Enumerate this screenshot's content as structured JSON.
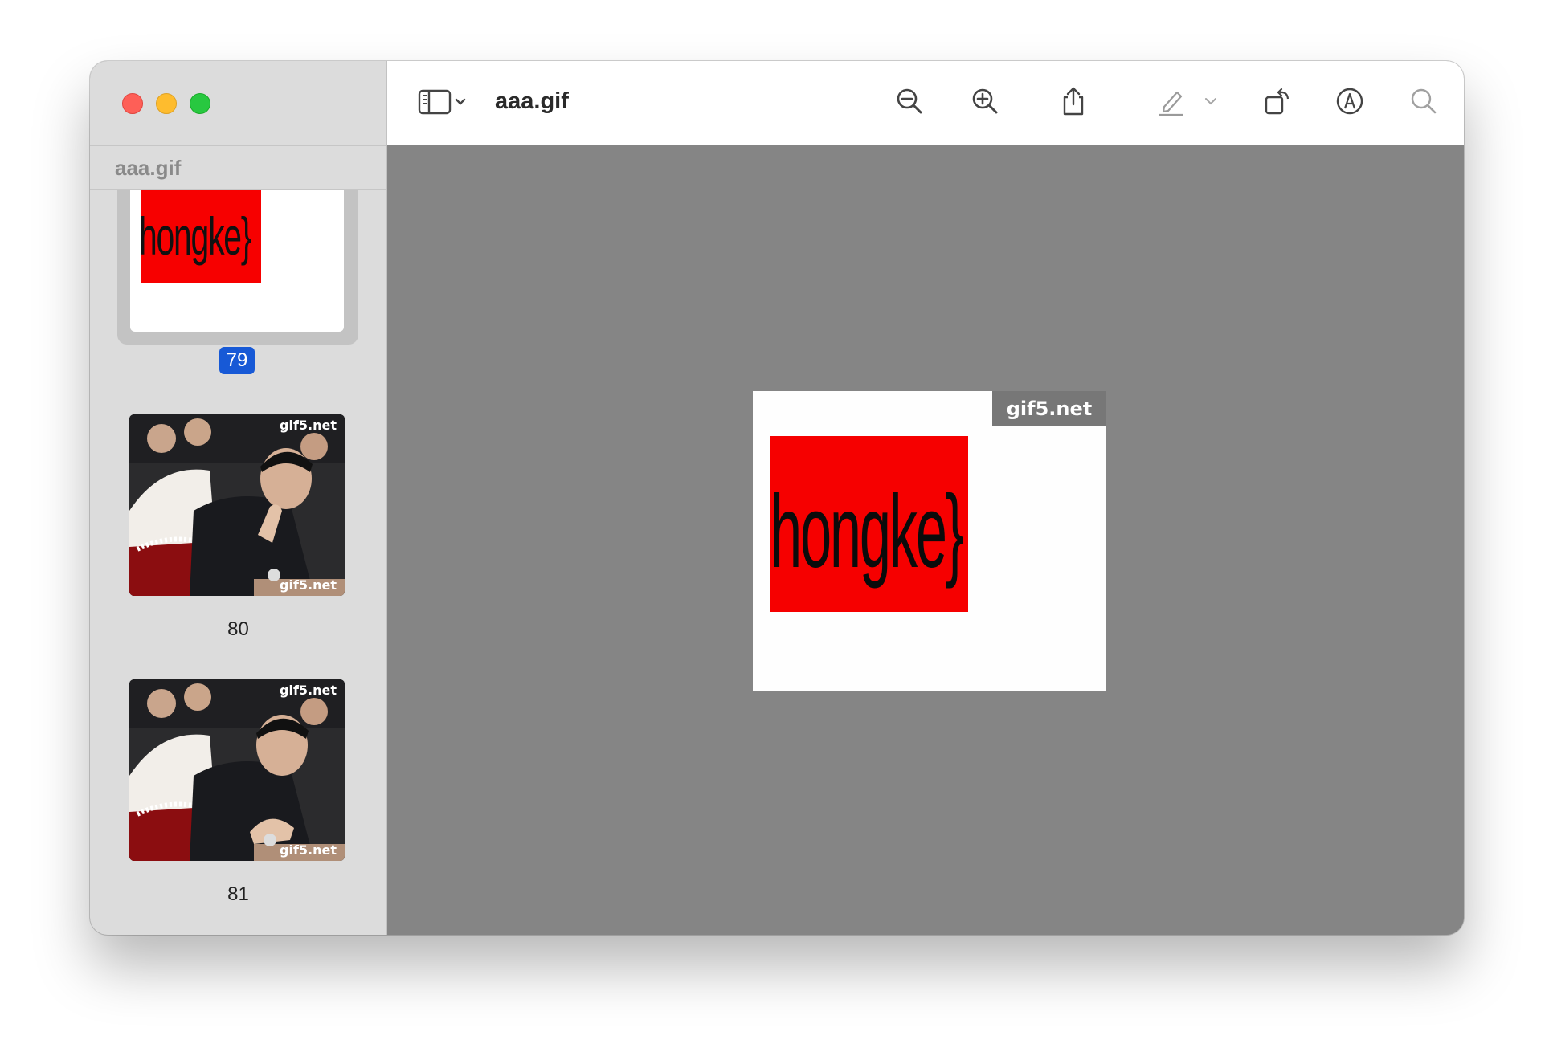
{
  "window": {
    "title": "aaa.gif"
  },
  "sidebar": {
    "title": "aaa.gif",
    "selected_thumb": {
      "page": "79",
      "text": "hongke}"
    },
    "thumbs": [
      {
        "page": "80",
        "watermark_top": "gif5.net",
        "watermark_bottom": "gif5.net"
      },
      {
        "page": "81",
        "watermark_top": "gif5.net",
        "watermark_bottom": "gif5.net"
      }
    ]
  },
  "toolbar": {
    "icons": [
      "sidebar-toggle-icon",
      "chevron-down-icon",
      "zoom-out-icon",
      "zoom-in-icon",
      "share-icon",
      "highlight-pen-icon",
      "chevron-down-icon",
      "rotate-icon",
      "markup-icon",
      "search-icon"
    ]
  },
  "canvas": {
    "watermark": "gif5.net",
    "frame_text": "hongke}",
    "colors": {
      "background": "#858585",
      "red": "#f60000",
      "watermark_bg": "#777777"
    }
  }
}
